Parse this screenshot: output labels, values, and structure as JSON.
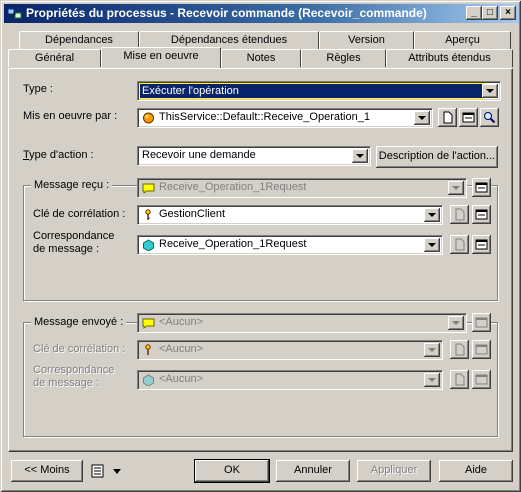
{
  "window": {
    "title": "Propriétés du processus - Recevoir commande (Recevoir_commande)",
    "controls": {
      "minimize": "_",
      "maximize": "□",
      "close": "×"
    }
  },
  "tabs": {
    "row1": [
      "Dépendances",
      "Dépendances étendues",
      "Version",
      "Aperçu"
    ],
    "row2": [
      "Général",
      "Mise en oeuvre",
      "Notes",
      "Règles",
      "Attributs étendus"
    ],
    "active": "Mise en oeuvre"
  },
  "form": {
    "type_label": "Type :",
    "type_value": "Exécuter l'opération",
    "impl_label": "Mis en oeuvre par :",
    "impl_value": "ThisService::Default::Receive_Operation_1",
    "action_label": "Type d'action :",
    "action_value": "Recevoir une demande",
    "action_desc_button": "Description de l'action..."
  },
  "received": {
    "title": "Message reçu :",
    "message_value": "Receive_Operation_1Request",
    "correlation_label": "Clé de corrélation :",
    "correlation_value": "GestionClient",
    "mapping_label_1": "Correspondance",
    "mapping_label_2": "de message :",
    "mapping_value": "Receive_Operation_1Request"
  },
  "sent": {
    "title": "Message envoyé :",
    "message_value": "<Aucun>",
    "correlation_label": "Clé de corrélation :",
    "correlation_value": "<Aucun>",
    "mapping_label_1": "Correspondance",
    "mapping_label_2": "de message :",
    "mapping_value": "<Aucun>"
  },
  "footer": {
    "less_button": "<< Moins",
    "ok_button": "OK",
    "cancel_button": "Annuler",
    "apply_button": "Appliquer",
    "help_button": "Aide"
  },
  "colors": {
    "selection": "#0a246a",
    "face": "#d4d0c8",
    "title_start": "#0a246a",
    "title_end": "#a6caf0"
  },
  "icons": [
    "process-icon",
    "operation-icon",
    "message-icon",
    "key-icon",
    "mapping-icon",
    "properties-icon",
    "find-icon",
    "list-icon"
  ]
}
